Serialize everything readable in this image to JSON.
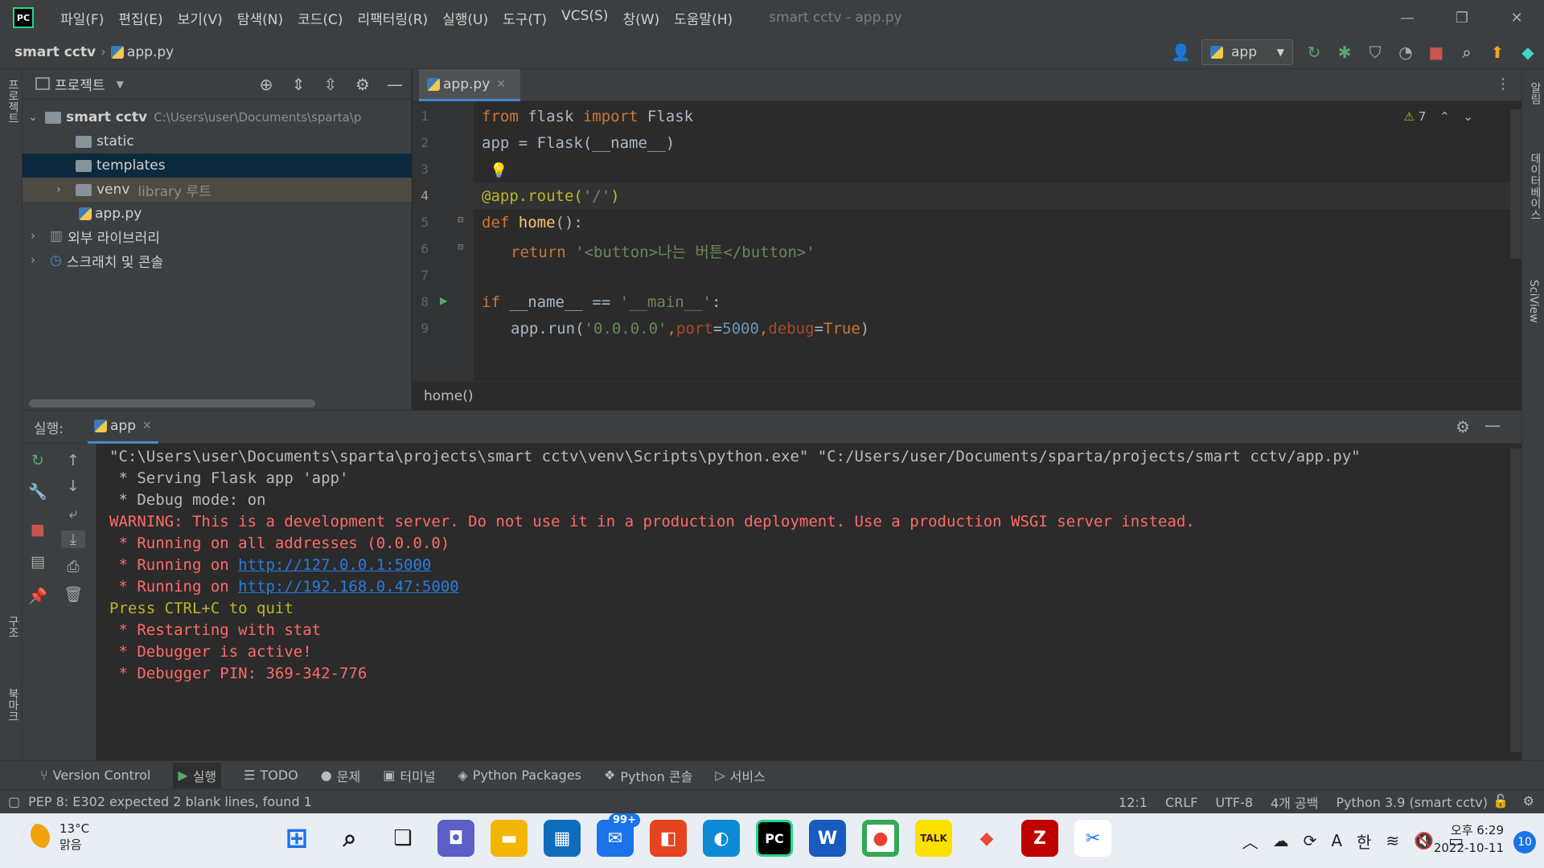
{
  "window": {
    "title": "smart cctv - app.py",
    "menu": [
      "파일(F)",
      "편집(E)",
      "보기(V)",
      "탐색(N)",
      "코드(C)",
      "리팩터링(R)",
      "실행(U)",
      "도구(T)",
      "VCS(S)",
      "창(W)",
      "도움말(H)"
    ],
    "logo_text": "PC"
  },
  "navbar": {
    "project": "smart cctv",
    "file": "app.py",
    "run_config": "app"
  },
  "left_stripe": {
    "project": "프로젝트",
    "structure": "구조",
    "bookmarks": "북마크"
  },
  "right_stripe": {
    "notifications": "알림",
    "database": "데이터베이스",
    "sciview": "SciView"
  },
  "project_panel": {
    "title": "프로젝트",
    "root_name": "smart cctv",
    "root_path": "C:\\Users\\user\\Documents\\sparta\\p",
    "static": "static",
    "templates": "templates",
    "venv": "venv",
    "venv_hint": "library 루트",
    "app_file": "app.py",
    "external_libs": "외부 라이브러리",
    "scratches": "스크래치 및 콘솔"
  },
  "editor": {
    "tab": "app.py",
    "warnings": "7",
    "line_numbers": [
      "1",
      "2",
      "3",
      "4",
      "5",
      "6",
      "7",
      "8",
      "9"
    ],
    "breadcrumb": "home()",
    "code": {
      "l1_from": "from",
      "l1_mod": " flask ",
      "l1_import": "import",
      "l1_name": " Flask",
      "l2": "app = Flask(__name__)",
      "l4_dec": "@app.route(",
      "l4_str": "'/'",
      "l4_end": ")",
      "l5_def": "def",
      "l5_fn": " home",
      "l5_rest": "():",
      "l6_return": "return",
      "l6_str": " '<button>나는 버튼</button>'",
      "l8_if": "if",
      "l8_mid": " __name__ == ",
      "l8_str": "'__main__'",
      "l8_end": ":",
      "l9_a": "app.run(",
      "l9_host": "'0.0.0.0'",
      "l9_c1": ",",
      "l9_port": "port",
      "l9_eq1": "=",
      "l9_num": "5000",
      "l9_c2": ",",
      "l9_debug": "debug",
      "l9_eq2": "=",
      "l9_true": "True",
      "l9_end": ")"
    }
  },
  "run_panel": {
    "label": "실행:",
    "tab": "app",
    "output": {
      "cmd": "\"C:\\Users\\user\\Documents\\sparta\\projects\\smart cctv\\venv\\Scripts\\python.exe\" \"C:/Users/user/Documents/sparta/projects/smart cctv/app.py\"",
      "serving": " * Serving Flask app 'app'",
      "debug_mode": " * Debug mode: on",
      "warning": "WARNING: This is a development server. Do not use it in a production deployment. Use a production WSGI server instead.",
      "all_addr": " * Running on all addresses (0.0.0.0)",
      "run1_prefix": " * Running on ",
      "run1_link": "http://127.0.0.1:5000",
      "run2_prefix": " * Running on ",
      "run2_link": "http://192.168.0.47:5000",
      "quit": "Press CTRL+C to quit",
      "restart": " * Restarting with stat",
      "debugger": " * Debugger is active!",
      "pin": " * Debugger PIN: 369-342-776"
    }
  },
  "tool_windows": [
    "Version Control",
    "실행",
    "TODO",
    "문제",
    "터미널",
    "Python Packages",
    "Python 콘솔",
    "서비스"
  ],
  "statusbar": {
    "message": "PEP 8: E302 expected 2 blank lines, found 1",
    "position": "12:1",
    "line_sep": "CRLF",
    "encoding": "UTF-8",
    "indent": "4개 공백",
    "interpreter": "Python 3.9 (smart cctv)"
  },
  "taskbar": {
    "temperature": "13°C",
    "weather": "맑음",
    "mail_badge": "99+",
    "ime": "한",
    "time": "오후 6:29",
    "date": "2022-10-11",
    "notifications": "10",
    "font_letter": "A"
  }
}
